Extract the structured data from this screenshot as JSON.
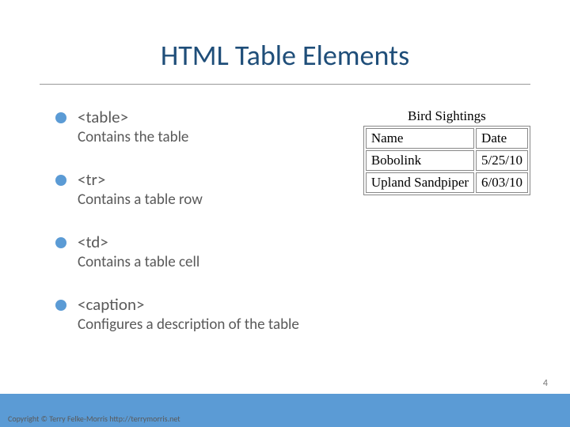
{
  "title": "HTML Table Elements",
  "bullets": [
    {
      "name": "<table>",
      "desc": "Contains the table"
    },
    {
      "name": "<tr>",
      "desc": "Contains a table row"
    },
    {
      "name": "<td>",
      "desc": "Contains a table cell"
    },
    {
      "name": "<caption>",
      "desc": "Configures a description of the table"
    }
  ],
  "sample_table": {
    "caption": "Bird Sightings",
    "headers": [
      "Name",
      "Date"
    ],
    "rows": [
      [
        "Bobolink",
        "5/25/10"
      ],
      [
        "Upland Sandpiper",
        "6/03/10"
      ]
    ]
  },
  "footer": {
    "copyright": "Copyright © Terry Felke-Morris http://terrymorris.net",
    "slide_number": "4"
  }
}
